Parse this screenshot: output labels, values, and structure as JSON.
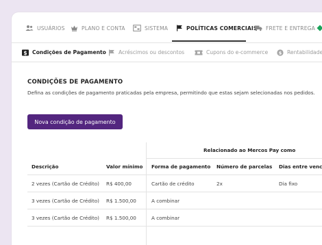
{
  "top_nav": {
    "items": [
      {
        "label": "USUÁRIOS",
        "icon": "users-icon"
      },
      {
        "label": "PLANO E CONTA",
        "icon": "crown-icon"
      },
      {
        "label": "SISTEMA",
        "icon": "system-icon"
      },
      {
        "label": "POLÍTICAS COMERCIAIS",
        "icon": "flag-icon",
        "active": true
      },
      {
        "label": "FRETE E ENTREGA",
        "icon": "truck-icon"
      }
    ]
  },
  "sub_nav": {
    "items": [
      {
        "label": "Condições de Pagamento",
        "icon": "dollar-icon",
        "active": true
      },
      {
        "label": "Acréscimos ou descontos",
        "icon": "flag-icon"
      },
      {
        "label": "Cupons do e-commerce",
        "icon": "ticket-icon"
      },
      {
        "label": "Rentabilidade",
        "icon": "coin-icon"
      }
    ]
  },
  "page": {
    "title": "CONDIÇÕES DE PAGAMENTO",
    "description": "Defina as condições de pagamento praticadas pela empresa, permitindo que estas sejam selecionadas nos pedidos.",
    "new_button": "Nova condição de pagamento"
  },
  "table": {
    "group_header": "Relacionado ao Mercos Pay como",
    "columns": [
      "Descrição",
      "Valor mínimo",
      "Forma de pagamento",
      "Número de parcelas",
      "Dias entre vencimentos"
    ],
    "rows": [
      [
        "2 vezes (Cartão de Crédito)",
        "R$ 400,00",
        "Cartão de crédito",
        "2x",
        "Dia fixo"
      ],
      [
        "3 vezes (Cartão de Crédito)",
        "R$ 1.500,00",
        "A combinar",
        "",
        ""
      ],
      [
        "3 vezes (Cartão de Crédito)",
        "R$ 1.500,00",
        "A combinar",
        "",
        ""
      ]
    ]
  },
  "colors": {
    "background": "#ece5f2",
    "primary_button": "#53267f",
    "green_accent": "#1aa35a"
  }
}
